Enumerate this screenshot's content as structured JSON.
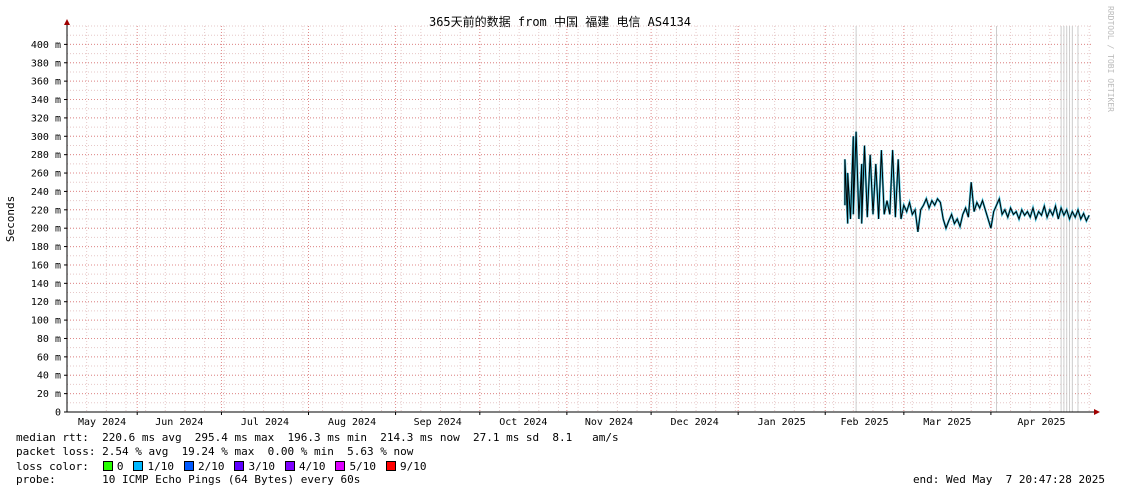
{
  "chart_data": {
    "type": "line",
    "title": "365天前的数据 from 中国 福建 电信 AS4134",
    "ylabel": "Seconds",
    "watermark": "RRDTOOL / TOBI OETIKER",
    "ylim": [
      0,
      420
    ],
    "yticks": [
      {
        "v": 0,
        "label": "0"
      },
      {
        "v": 20,
        "label": "20 m"
      },
      {
        "v": 40,
        "label": "40 m"
      },
      {
        "v": 60,
        "label": "60 m"
      },
      {
        "v": 80,
        "label": "80 m"
      },
      {
        "v": 100,
        "label": "100 m"
      },
      {
        "v": 120,
        "label": "120 m"
      },
      {
        "v": 140,
        "label": "140 m"
      },
      {
        "v": 160,
        "label": "160 m"
      },
      {
        "v": 180,
        "label": "180 m"
      },
      {
        "v": 200,
        "label": "200 m"
      },
      {
        "v": 220,
        "label": "220 m"
      },
      {
        "v": 240,
        "label": "240 m"
      },
      {
        "v": 260,
        "label": "260 m"
      },
      {
        "v": 280,
        "label": "280 m"
      },
      {
        "v": 300,
        "label": "300 m"
      },
      {
        "v": 320,
        "label": "320 m"
      },
      {
        "v": 340,
        "label": "340 m"
      },
      {
        "v": 360,
        "label": "360 m"
      },
      {
        "v": 380,
        "label": "380 m"
      },
      {
        "v": 400,
        "label": "400 m"
      }
    ],
    "xlim": [
      "2024-05-07",
      "2025-05-07"
    ],
    "months": [
      {
        "label": "May 2024",
        "date": "2024-05-01"
      },
      {
        "label": "Jun 2024",
        "date": "2024-06-01"
      },
      {
        "label": "Jul 2024",
        "date": "2024-07-01"
      },
      {
        "label": "Aug 2024",
        "date": "2024-08-01"
      },
      {
        "label": "Sep 2024",
        "date": "2024-09-01"
      },
      {
        "label": "Oct 2024",
        "date": "2024-10-01"
      },
      {
        "label": "Nov 2024",
        "date": "2024-11-01"
      },
      {
        "label": "Dec 2024",
        "date": "2024-12-01"
      },
      {
        "label": "Jan 2025",
        "date": "2025-01-01"
      },
      {
        "label": "Feb 2025",
        "date": "2025-02-01"
      },
      {
        "label": "Mar 2025",
        "date": "2025-03-01"
      },
      {
        "label": "Apr 2025",
        "date": "2025-04-01"
      }
    ],
    "series": [
      {
        "color": "#000000",
        "points": [
          [
            "2025-02-08",
            225
          ],
          [
            "2025-02-08",
            275
          ],
          [
            "2025-02-09",
            205
          ],
          [
            "2025-02-09",
            260
          ],
          [
            "2025-02-10",
            210
          ],
          [
            "2025-02-11",
            300
          ],
          [
            "2025-02-11",
            215
          ],
          [
            "2025-02-12",
            305
          ],
          [
            "2025-02-13",
            210
          ],
          [
            "2025-02-14",
            270
          ],
          [
            "2025-02-14",
            205
          ],
          [
            "2025-02-15",
            290
          ],
          [
            "2025-02-16",
            212
          ],
          [
            "2025-02-17",
            280
          ],
          [
            "2025-02-18",
            215
          ],
          [
            "2025-02-19",
            270
          ],
          [
            "2025-02-20",
            210
          ],
          [
            "2025-02-21",
            285
          ],
          [
            "2025-02-22",
            215
          ],
          [
            "2025-02-23",
            230
          ],
          [
            "2025-02-24",
            215
          ],
          [
            "2025-02-25",
            285
          ],
          [
            "2025-02-26",
            212
          ],
          [
            "2025-02-27",
            275
          ],
          [
            "2025-02-28",
            210
          ],
          [
            "2025-03-01",
            225
          ],
          [
            "2025-03-02",
            218
          ],
          [
            "2025-03-03",
            228
          ],
          [
            "2025-03-04",
            215
          ],
          [
            "2025-03-05",
            220
          ],
          [
            "2025-03-06",
            196
          ],
          [
            "2025-03-07",
            220
          ],
          [
            "2025-03-08",
            225
          ],
          [
            "2025-03-09",
            232
          ],
          [
            "2025-03-10",
            222
          ],
          [
            "2025-03-11",
            230
          ],
          [
            "2025-03-12",
            225
          ],
          [
            "2025-03-13",
            232
          ],
          [
            "2025-03-14",
            228
          ],
          [
            "2025-03-15",
            210
          ],
          [
            "2025-03-16",
            200
          ],
          [
            "2025-03-17",
            208
          ],
          [
            "2025-03-18",
            215
          ],
          [
            "2025-03-19",
            205
          ],
          [
            "2025-03-20",
            210
          ],
          [
            "2025-03-21",
            202
          ],
          [
            "2025-03-22",
            215
          ],
          [
            "2025-03-23",
            222
          ],
          [
            "2025-03-24",
            212
          ],
          [
            "2025-03-25",
            250
          ],
          [
            "2025-03-26",
            218
          ],
          [
            "2025-03-27",
            228
          ],
          [
            "2025-03-28",
            222
          ],
          [
            "2025-03-29",
            230
          ],
          [
            "2025-03-30",
            220
          ],
          [
            "2025-03-31",
            210
          ],
          [
            "2025-04-01",
            200
          ],
          [
            "2025-04-02",
            218
          ],
          [
            "2025-04-03",
            225
          ],
          [
            "2025-04-04",
            232
          ],
          [
            "2025-04-05",
            215
          ],
          [
            "2025-04-06",
            220
          ],
          [
            "2025-04-07",
            212
          ],
          [
            "2025-04-08",
            222
          ],
          [
            "2025-04-09",
            215
          ],
          [
            "2025-04-10",
            218
          ],
          [
            "2025-04-11",
            210
          ],
          [
            "2025-04-12",
            220
          ],
          [
            "2025-04-13",
            214
          ],
          [
            "2025-04-14",
            218
          ],
          [
            "2025-04-15",
            212
          ],
          [
            "2025-04-16",
            222
          ],
          [
            "2025-04-17",
            210
          ],
          [
            "2025-04-18",
            218
          ],
          [
            "2025-04-19",
            214
          ],
          [
            "2025-04-20",
            224
          ],
          [
            "2025-04-21",
            212
          ],
          [
            "2025-04-22",
            220
          ],
          [
            "2025-04-23",
            214
          ],
          [
            "2025-04-24",
            224
          ],
          [
            "2025-04-25",
            210
          ],
          [
            "2025-04-26",
            222
          ],
          [
            "2025-04-27",
            214
          ],
          [
            "2025-04-28",
            220
          ],
          [
            "2025-04-29",
            210
          ],
          [
            "2025-04-30",
            218
          ],
          [
            "2025-05-01",
            212
          ],
          [
            "2025-05-02",
            220
          ],
          [
            "2025-05-03",
            210
          ],
          [
            "2025-05-04",
            216
          ],
          [
            "2025-05-05",
            208
          ],
          [
            "2025-05-06",
            214
          ]
        ]
      }
    ],
    "spikes": [
      "2025-02-12",
      "2025-04-03",
      "2025-04-26",
      "2025-04-27",
      "2025-04-28",
      "2025-04-29",
      "2025-04-30",
      "2025-05-02"
    ],
    "grid": true
  },
  "stats": {
    "median": "median rtt:  220.6 ms avg  295.4 ms max  196.3 ms min  214.3 ms now  27.1 ms sd  8.1   am/s",
    "loss": "packet loss: 2.54 % avg  19.24 % max  0.00 % min  5.63 % now",
    "loss_color_label": "loss color:",
    "probe": "probe:       10 ICMP Echo Pings (64 Bytes) every 60s",
    "end": "end: Wed May  7 20:47:28 2025"
  },
  "legend": [
    {
      "label": "0",
      "color": "#26ff00"
    },
    {
      "label": "1/10",
      "color": "#00b8ff"
    },
    {
      "label": "2/10",
      "color": "#0059ff"
    },
    {
      "label": "3/10",
      "color": "#5e00ff"
    },
    {
      "label": "4/10",
      "color": "#7e00ff"
    },
    {
      "label": "5/10",
      "color": "#dd00ff"
    },
    {
      "label": "9/10",
      "color": "#ff0000"
    }
  ]
}
